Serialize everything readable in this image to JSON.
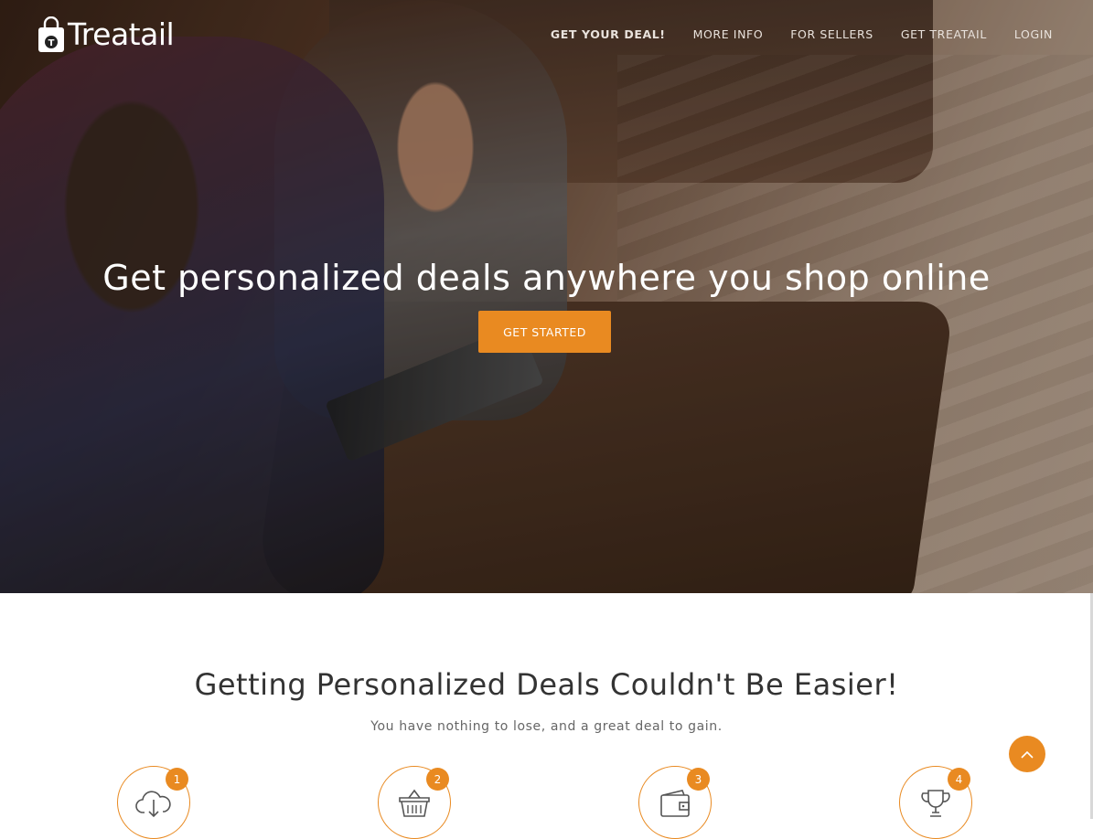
{
  "brand": {
    "name": "Treatail",
    "logo_letter": "T"
  },
  "nav": {
    "items": [
      {
        "label": "GET YOUR DEAL!",
        "active": true
      },
      {
        "label": "MORE INFO",
        "active": false
      },
      {
        "label": "FOR SELLERS",
        "active": false
      },
      {
        "label": "GET TREATAIL",
        "active": false
      },
      {
        "label": "LOGIN",
        "active": false
      }
    ]
  },
  "hero": {
    "title": "Get personalized deals anywhere you shop online",
    "cta_label": "GET STARTED"
  },
  "section": {
    "title": "Getting Personalized Deals Couldn't Be Easier!",
    "subtitle": "You have nothing to lose, and a great deal to gain.",
    "steps": [
      {
        "number": "1",
        "icon": "cloud-download-icon"
      },
      {
        "number": "2",
        "icon": "shopping-basket-icon"
      },
      {
        "number": "3",
        "icon": "wallet-icon"
      },
      {
        "number": "4",
        "icon": "trophy-icon"
      }
    ]
  },
  "colors": {
    "accent": "#e98a21",
    "heading": "#333333",
    "subtext": "#666666"
  }
}
